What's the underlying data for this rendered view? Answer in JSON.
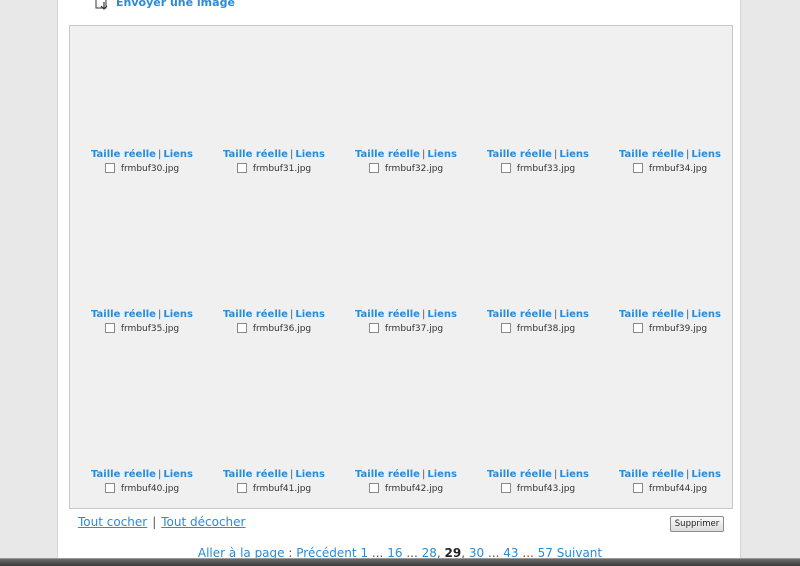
{
  "header": {
    "upload_label": "Envoyer une image",
    "upload_icon": "upload-image-icon"
  },
  "gallery": {
    "link_real_size": "Taille réelle",
    "link_separator": "|",
    "link_links": "Liens",
    "files": [
      "frmbuf30.jpg",
      "frmbuf31.jpg",
      "frmbuf32.jpg",
      "frmbuf33.jpg",
      "frmbuf34.jpg",
      "frmbuf35.jpg",
      "frmbuf36.jpg",
      "frmbuf37.jpg",
      "frmbuf38.jpg",
      "frmbuf39.jpg",
      "frmbuf40.jpg",
      "frmbuf41.jpg",
      "frmbuf42.jpg",
      "frmbuf43.jpg",
      "frmbuf44.jpg"
    ]
  },
  "selection": {
    "check_all": "Tout cocher",
    "separator": "|",
    "uncheck_all": "Tout décocher"
  },
  "actions": {
    "delete_label": "Supprimer"
  },
  "pagination": {
    "goto_label": "Aller à la page",
    "colon": ":",
    "previous": "Précédent",
    "ellipsis": "...",
    "comma": ",",
    "pages": [
      "1",
      "16",
      "28",
      "29",
      "30",
      "43",
      "57"
    ],
    "current": "29",
    "next": "Suivant"
  },
  "colors": {
    "link": "#2a8bd6",
    "gallery_bg": "#f0f0f0",
    "page_bg": "#ffffff"
  }
}
